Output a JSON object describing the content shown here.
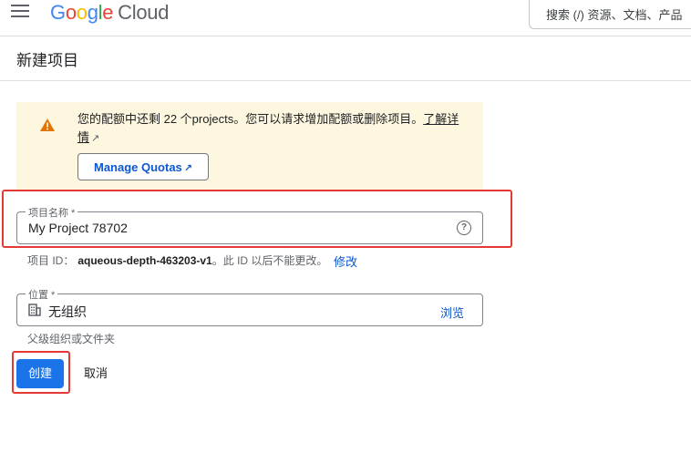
{
  "header": {
    "logo_google": [
      "G",
      "o",
      "o",
      "g",
      "l",
      "e"
    ],
    "logo_cloud": "Cloud",
    "search_placeholder": "搜索 (/) 资源、文档、产品"
  },
  "page": {
    "title": "新建项目"
  },
  "quota": {
    "message": "您的配额中还剩 22 个projects。您可以请求增加配额或删除项目。",
    "learn_more": "了解详情",
    "manage_button": "Manage Quotas"
  },
  "project_name": {
    "label": "项目名称 *",
    "value": "My Project 78702"
  },
  "project_id": {
    "prefix": "项目 ID：",
    "value": "aqueous-depth-463203-v1",
    "suffix": "。此 ID 以后不能更改。",
    "edit_label": "修改"
  },
  "location": {
    "label": "位置 *",
    "value": "无组织",
    "browse_label": "浏览",
    "hint": "父级组织或文件夹"
  },
  "actions": {
    "create_label": "创建",
    "cancel_label": "取消"
  },
  "colors": {
    "primary": "#1a73e8",
    "warning_bg": "#fef7e0",
    "highlight": "#e53935"
  }
}
